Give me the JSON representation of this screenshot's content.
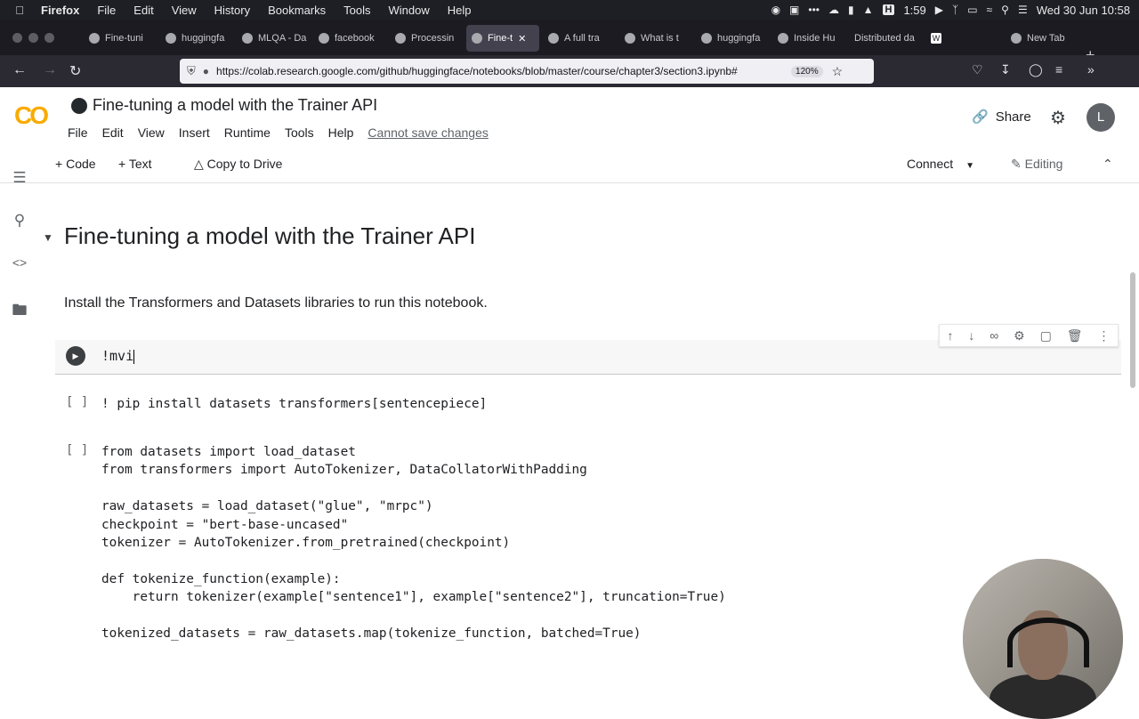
{
  "menubar": {
    "app": "Firefox",
    "items": [
      "File",
      "Edit",
      "View",
      "History",
      "Bookmarks",
      "Tools",
      "Window",
      "Help"
    ],
    "status": {
      "h_badge": "H",
      "timer": "1:59",
      "datetime": "Wed 30 Jun  10:58"
    }
  },
  "tabs": [
    {
      "label": "Fine-tuni",
      "icon": "colab-icon"
    },
    {
      "label": "huggingfa",
      "icon": "github-icon"
    },
    {
      "label": "MLQA - Da",
      "icon": "huggingface-icon"
    },
    {
      "label": "facebook",
      "icon": "huggingface-icon"
    },
    {
      "label": "Processin",
      "icon": "colab-icon"
    },
    {
      "label": "Fine-t",
      "icon": "colab-icon",
      "active": true
    },
    {
      "label": "A full tra",
      "icon": "colab-icon"
    },
    {
      "label": "What is t",
      "icon": "loading-icon"
    },
    {
      "label": "huggingfa",
      "icon": "github-icon"
    },
    {
      "label": "Inside Hu",
      "icon": "grid-icon"
    },
    {
      "label": "Distributed da",
      "icon": "page-icon"
    },
    {
      "label": "",
      "icon": "wikipedia-icon"
    },
    {
      "label": "New Tab",
      "icon": "newtab-icon"
    }
  ],
  "navbar": {
    "url": "https://colab.research.google.com/github/huggingface/notebooks/blob/master/course/chapter3/section3.ipynb#",
    "zoom": "120%"
  },
  "colab": {
    "logo": "CO",
    "title": "Fine-tuning a model with the Trainer API",
    "menu": [
      "File",
      "Edit",
      "View",
      "Insert",
      "Runtime",
      "Tools",
      "Help"
    ],
    "cannot_save": "Cannot save changes",
    "share": "Share",
    "avatar": "L",
    "toolbar": {
      "code": "Code",
      "text": "Text",
      "copy": "Copy to Drive",
      "connect": "Connect",
      "editing": "Editing"
    }
  },
  "notebook": {
    "heading": "Fine-tuning a model with the Trainer API",
    "intro": "Install the Transformers and Datasets libraries to run this notebook.",
    "active_cell": "!mvi",
    "cell1": {
      "bracket": "[ ]",
      "code": "! pip install datasets transformers[sentencepiece]"
    },
    "cell2": {
      "bracket": "[ ]",
      "lines": [
        "from datasets import load_dataset",
        "from transformers import AutoTokenizer, DataCollatorWithPadding",
        "",
        "raw_datasets = load_dataset(\"glue\", \"mrpc\")",
        "checkpoint = \"bert-base-uncased\"",
        "tokenizer = AutoTokenizer.from_pretrained(checkpoint)",
        "",
        "def tokenize_function(example):",
        "    return tokenizer(example[\"sentence1\"], example[\"sentence2\"], truncation=True)",
        "",
        "tokenized_datasets = raw_datasets.map(tokenize_function, batched=True)"
      ]
    }
  }
}
